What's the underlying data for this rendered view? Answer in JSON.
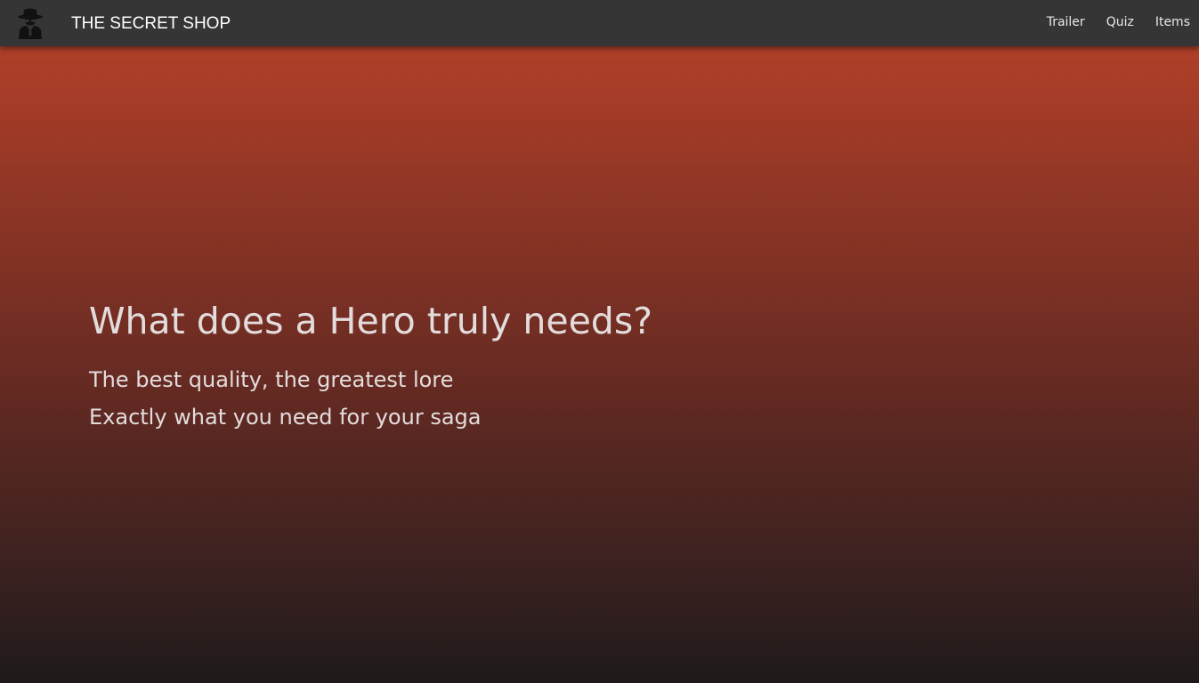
{
  "navbar": {
    "logo_icon": "spy-agent-icon",
    "brand": "THE SECRET SHOP",
    "links": [
      {
        "label": "Trailer"
      },
      {
        "label": "Quiz"
      },
      {
        "label": "Items"
      }
    ],
    "background_color": "#353535"
  },
  "hero": {
    "title": "What does a Hero truly needs?",
    "lines": [
      "The best quality, the greatest lore",
      "Exactly what you need for your saga"
    ],
    "gradient_top_color": "#b9432a",
    "gradient_bottom_color": "#1e1a1a"
  }
}
